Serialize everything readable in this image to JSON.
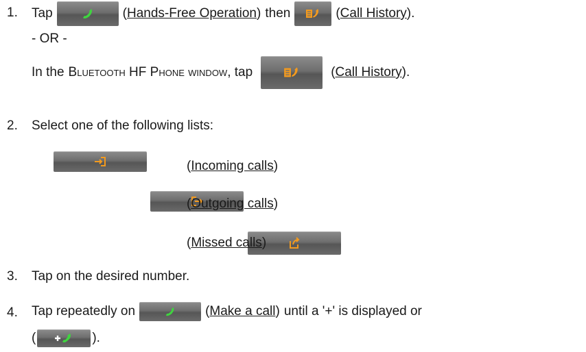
{
  "step1": {
    "number": "1.",
    "tap": "Tap",
    "btn1_icon": "phone-handset-icon",
    "link1": "Hands-Free Operation",
    "then": "then",
    "btn2_icon": "call-history-icon",
    "link2": "Call History",
    "or": "- OR -",
    "in_the": "In the",
    "window_name": "Bluetooth HF Phone window",
    "tap2": ", tap",
    "btn3_icon": "call-history-icon",
    "link3": "Call History"
  },
  "step2": {
    "number": "2.",
    "text": "Select one of the following lists:",
    "options": [
      {
        "icon": "incoming-call-icon",
        "label": "Incoming calls"
      },
      {
        "icon": "outgoing-call-icon",
        "label": "Outgoing calls"
      },
      {
        "icon": "missed-call-icon",
        "label": "Missed calls"
      }
    ]
  },
  "step3": {
    "number": "3.",
    "text": "Tap on the desired number."
  },
  "step4": {
    "number": "4.",
    "text1": "Tap repeatedly on",
    "btn_icon": "make-call-icon",
    "link": "Make a call",
    "text2": "until a '+' is displayed or",
    "btn2_icon": "plus-call-icon"
  },
  "colors": {
    "button": "#6e6e6e",
    "green_icon": "#3fd43f",
    "orange_icon": "#f39a1e",
    "text": "#1a1a1a"
  }
}
